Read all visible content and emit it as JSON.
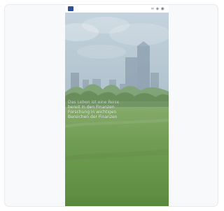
{
  "status_bar": {
    "right_text": "∞ ◈ ◉",
    "app_icon_color": "#2f4f9d"
  },
  "hero_caption": {
    "lines": [
      "Das Leben ist eine Reise",
      "bereit in den Finanzen",
      "Forschung in wichtigen",
      "Bereichen der Finanzen"
    ]
  },
  "scene_image": {
    "description_icon": "city-park-image",
    "sky_color": "#a9c0cf",
    "grass_color": "#5f8f3f"
  }
}
